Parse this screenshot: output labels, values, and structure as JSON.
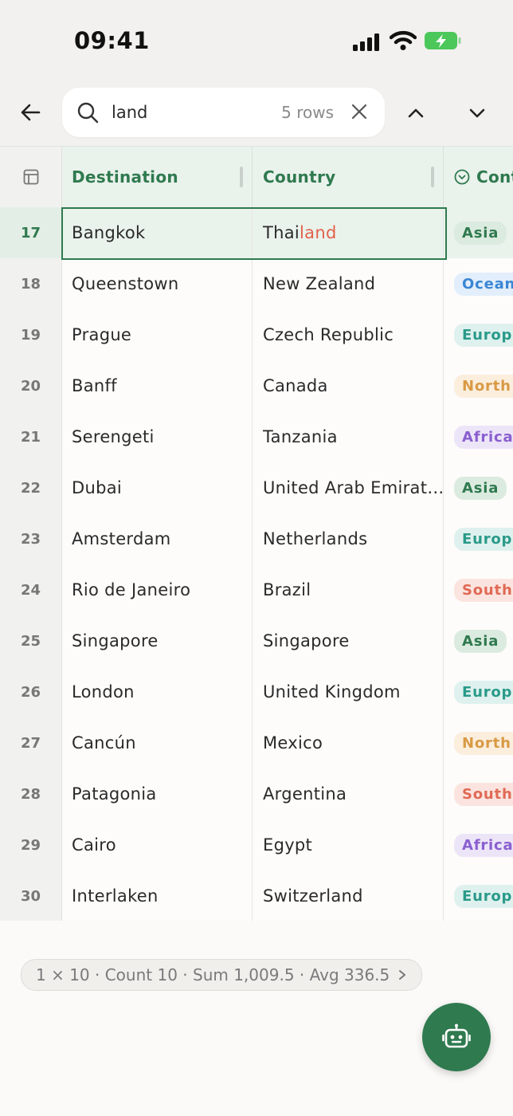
{
  "status": {
    "time": "09:41"
  },
  "search": {
    "query": "land",
    "result_count": "5 rows"
  },
  "columns": [
    {
      "label": "Destination"
    },
    {
      "label": "Country"
    },
    {
      "label": "Cont"
    }
  ],
  "rows": [
    {
      "num": "17",
      "destination": "Bangkok",
      "country_pre": "Thai",
      "country_match": "land",
      "continent": "Asia",
      "cont_color": "#2f7a4f",
      "cont_bg": "#dcebe0",
      "selected": true
    },
    {
      "num": "18",
      "destination": "Queenstown",
      "country_pre": "New Zealand",
      "country_match": "",
      "continent": "Ocean",
      "cont_color": "#3a86d4",
      "cont_bg": "#e2eefb"
    },
    {
      "num": "19",
      "destination": "Prague",
      "country_pre": "Czech Republic",
      "country_match": "",
      "continent": "Europe",
      "cont_color": "#2a9a8a",
      "cont_bg": "#dff1ee"
    },
    {
      "num": "20",
      "destination": "Banff",
      "country_pre": "Canada",
      "country_match": "",
      "continent": "North A",
      "cont_color": "#d99a45",
      "cont_bg": "#fbeedd"
    },
    {
      "num": "21",
      "destination": "Serengeti",
      "country_pre": "Tanzania",
      "country_match": "",
      "continent": "Africa",
      "cont_color": "#8a5fd0",
      "cont_bg": "#ece5f8"
    },
    {
      "num": "22",
      "destination": "Dubai",
      "country_pre": "United Arab Emirat…",
      "country_match": "",
      "continent": "Asia",
      "cont_color": "#2f7a4f",
      "cont_bg": "#dcebe0"
    },
    {
      "num": "23",
      "destination": "Amsterdam",
      "country_pre": "Netherlands",
      "country_match": "",
      "continent": "Europe",
      "cont_color": "#2a9a8a",
      "cont_bg": "#dff1ee"
    },
    {
      "num": "24",
      "destination": "Rio de Janeiro",
      "country_pre": "Brazil",
      "country_match": "",
      "continent": "South",
      "cont_color": "#e06a55",
      "cont_bg": "#fbe4df"
    },
    {
      "num": "25",
      "destination": "Singapore",
      "country_pre": "Singapore",
      "country_match": "",
      "continent": "Asia",
      "cont_color": "#2f7a4f",
      "cont_bg": "#dcebe0"
    },
    {
      "num": "26",
      "destination": "London",
      "country_pre": "United Kingdom",
      "country_match": "",
      "continent": "Europe",
      "cont_color": "#2a9a8a",
      "cont_bg": "#dff1ee"
    },
    {
      "num": "27",
      "destination": "Cancún",
      "country_pre": "Mexico",
      "country_match": "",
      "continent": "North A",
      "cont_color": "#d99a45",
      "cont_bg": "#fbeedd"
    },
    {
      "num": "28",
      "destination": "Patagonia",
      "country_pre": "Argentina",
      "country_match": "",
      "continent": "South",
      "cont_color": "#e06a55",
      "cont_bg": "#fbe4df"
    },
    {
      "num": "29",
      "destination": "Cairo",
      "country_pre": "Egypt",
      "country_match": "",
      "continent": "Africa",
      "cont_color": "#8a5fd0",
      "cont_bg": "#ece5f8"
    },
    {
      "num": "30",
      "destination": "Interlaken",
      "country_pre": "Switzerland",
      "country_match": "",
      "continent": "Europe",
      "cont_color": "#2a9a8a",
      "cont_bg": "#dff1ee"
    }
  ],
  "summary": {
    "text": "1 × 10 · Count 10 · Sum 1,009.5 · Avg 336.5"
  },
  "colors": {
    "accent": "#2f7a4f",
    "highlight": "#e2614a"
  }
}
